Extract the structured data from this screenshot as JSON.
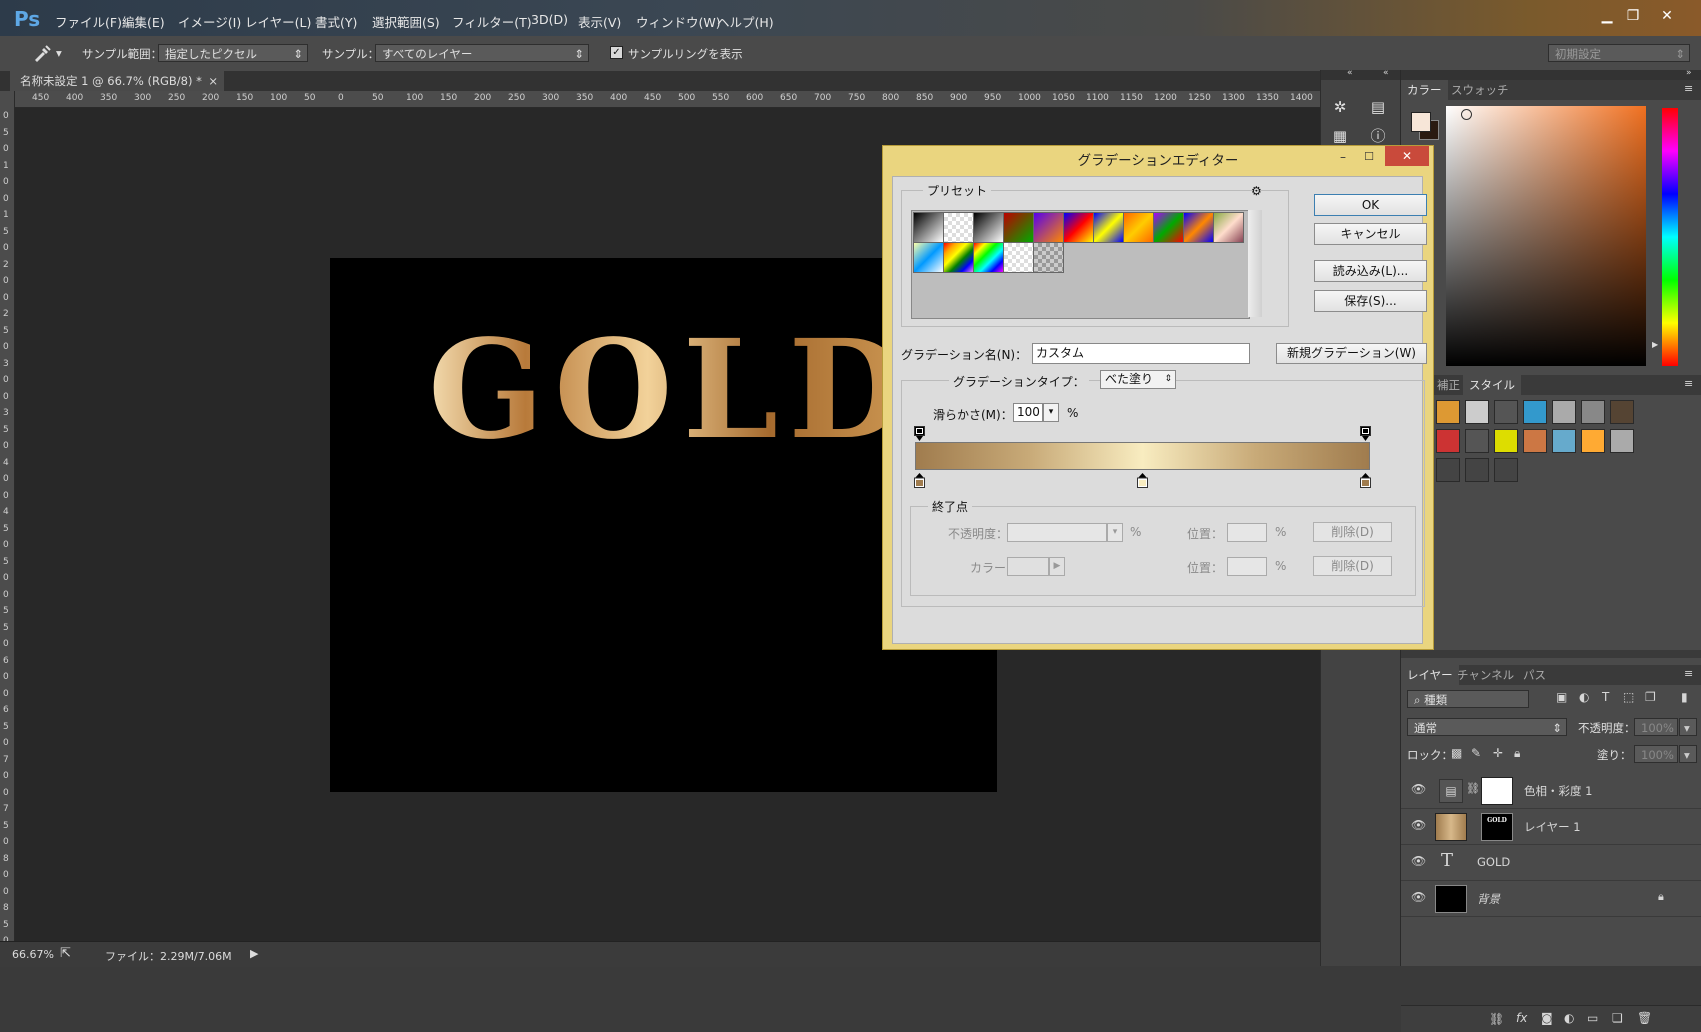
{
  "app": {
    "logo": "Ps",
    "menu": [
      "ファイル(F)",
      "編集(E)",
      "イメージ(I)",
      "レイヤー(L)",
      "書式(Y)",
      "選択範囲(S)",
      "フィルター(T)",
      "3D(D)",
      "表示(V)",
      "ウィンドウ(W)",
      "ヘルプ(H)"
    ],
    "window_controls": {
      "minimize": "▁",
      "restore": "❐",
      "close": "✕"
    }
  },
  "options": {
    "sample_size_label": "サンプル範囲：",
    "sample_size_value": "指定したピクセル",
    "sample_label": "サンプル：",
    "sample_value": "すべてのレイヤー",
    "show_ring_label": "サンプルリングを表示",
    "workspace": "初期設定"
  },
  "document": {
    "tab_title": "名称未設定 1 @ 66.7% (RGB/8) *",
    "tab_close": "×",
    "canvas_text": "GOLD",
    "ruler_h": [
      "450",
      "400",
      "350",
      "300",
      "250",
      "200",
      "150",
      "100",
      "50",
      "0",
      "50",
      "100",
      "150",
      "200",
      "250",
      "300",
      "350",
      "400",
      "450",
      "500",
      "550",
      "600",
      "650",
      "700",
      "750",
      "800",
      "850",
      "900",
      "950",
      "1000",
      "1050",
      "1100",
      "1150",
      "1200",
      "1250",
      "1300",
      "1350",
      "1400"
    ],
    "ruler_v": [
      "0",
      "5",
      "0",
      "1",
      "0",
      "0",
      "1",
      "5",
      "0",
      "2",
      "0",
      "0",
      "2",
      "5",
      "0",
      "3",
      "0",
      "0",
      "3",
      "5",
      "0",
      "4",
      "0",
      "0",
      "4",
      "5",
      "0",
      "5",
      "0",
      "0",
      "5",
      "5",
      "0",
      "6",
      "0",
      "0",
      "6",
      "5",
      "0",
      "7",
      "0",
      "0",
      "7",
      "5",
      "0",
      "8",
      "0",
      "0",
      "8",
      "5",
      "0"
    ]
  },
  "status": {
    "zoom": "66.67%",
    "file": "ファイル：2.29M/7.06M"
  },
  "panels": {
    "color_tabs": [
      "カラー",
      "スウォッチ"
    ],
    "style_tabs": [
      "補正",
      "スタイル"
    ],
    "layer_tabs": [
      "レイヤー",
      "チャンネル",
      "パス"
    ],
    "filter_kind": "種類",
    "blend_mode": "通常",
    "opacity_label": "不透明度：",
    "opacity_value": "100%",
    "lock_label": "ロック：",
    "fill_label": "塗り：",
    "fill_value": "100%",
    "layers": [
      {
        "name": "色相・彩度 1"
      },
      {
        "name": "レイヤー 1",
        "thumb_text": "GOLD"
      },
      {
        "name": "GOLD"
      },
      {
        "name": "背景"
      }
    ]
  },
  "dialog": {
    "title": "グラデーションエディター",
    "presets_label": "プリセット",
    "ok": "OK",
    "cancel": "キャンセル",
    "load": "読み込み(L)...",
    "save": "保存(S)...",
    "name_label": "グラデーション名(N)：",
    "name_value": "カスタム",
    "new_button": "新規グラデーション(W)",
    "type_label": "グラデーションタイプ：",
    "type_value": "べた塗り",
    "smooth_label": "滑らかさ(M)：",
    "smooth_value": "100",
    "smooth_unit": "%",
    "stops_label": "終了点",
    "opacity_label": "不透明度：",
    "opacity_unit": "%",
    "position_label": "位置：",
    "position_unit": "%",
    "delete_label": "削除(D)",
    "color_label": "カラー："
  },
  "colors": {
    "gold_dark": "#a07c4e",
    "gold_light": "#f8ecc0",
    "foreground": "#f7e6d8",
    "background": "#2a1a10"
  }
}
